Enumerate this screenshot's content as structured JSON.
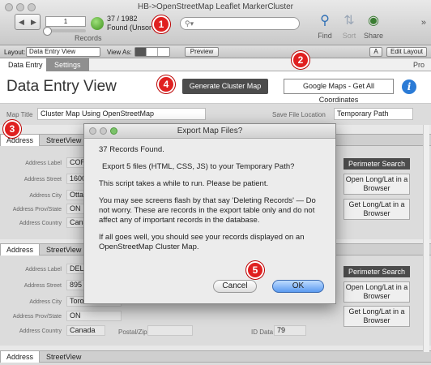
{
  "window": {
    "title": "HB->OpenStreetMap Leaflet MarkerCluster"
  },
  "toolbar": {
    "nav_prev": "◀",
    "nav_next": "▶",
    "record_number": "1",
    "records_label": "Records",
    "found_count": "37 / 1982",
    "found_status": "Found (Unsor",
    "search_placeholder": "",
    "find_label": "Find",
    "sort_label": "Sort",
    "share_label": "Share",
    "more_icon": "double-chevron"
  },
  "layoutbar": {
    "layout_label": "Layout:",
    "layout_value": "Data Entry View",
    "view_as_label": "View As:",
    "preview_label": "Preview",
    "font_size_label": "A",
    "edit_layout_label": "Edit Layout"
  },
  "tabs": {
    "data_entry": "Data Entry",
    "settings": "Settings",
    "pro": "Pro"
  },
  "header": {
    "title": "Data Entry View",
    "generate_button": "Generate Cluster Map",
    "google_maps_button": "Google Maps - Get All Coordinates"
  },
  "map_row": {
    "map_title_label": "Map Title",
    "map_title_value": "Cluster Map Using OpenStreetMap",
    "save_location_label": "Save File Location",
    "save_location_value": "Temporary Path"
  },
  "records": [
    {
      "tab_address": "Address",
      "tab_streetview": "StreetView",
      "address_label": "Address Label",
      "address_label_value": "COREL",
      "street_label": "Address Street",
      "street_value": "1600 Ca",
      "city_label": "Address City",
      "city_value": "Ottawa",
      "prov_label": "Address Prov/State",
      "prov_value": "ON",
      "country_label": "Address Country",
      "country_value": "Canada",
      "perimeter_button": "Perimeter Search",
      "open_longlat_button": "Open Long/Lat in a Browser",
      "get_longlat_button": "Get Long/Lat in a Browser"
    },
    {
      "tab_address": "Address",
      "tab_streetview": "StreetView",
      "address_label": "Address Label",
      "address_label_value": "DELRIN",
      "street_label": "Address Street",
      "street_value": "895 Don",
      "city_label": "Address City",
      "city_value": "Toronto",
      "prov_label": "Address Prov/State",
      "prov_value": "ON",
      "country_label": "Address Country",
      "country_value": "Canada",
      "postal_label": "Postal/Zip:",
      "id_label": "ID Data",
      "id_value": "79",
      "perimeter_button": "Perimeter Search",
      "open_longlat_button": "Open Long/Lat in a Browser",
      "get_longlat_button": "Get Long/Lat in a Browser"
    },
    {
      "tab_address": "Address",
      "tab_streetview": "StreetView"
    }
  ],
  "dialog": {
    "title": "Export Map Files?",
    "line1": "37 Records Found.",
    "line2": "Export 5 files (HTML, CSS, JS) to your Temporary Path?",
    "line3": "This script takes a while to run. Please be patient.",
    "line4": "You may see screens flash by that say 'Deleting Records' — Do not worry. These are records in the export table only and do not affect any of important records in the database.",
    "line5": "If all goes well, you should see your records displayed on an OpenStreetMap Cluster Map.",
    "cancel": "Cancel",
    "ok": "OK"
  },
  "badges": [
    "1",
    "2",
    "3",
    "4",
    "5"
  ],
  "colors": {
    "badge": "#e02020",
    "dark_button": "#4c4c4c",
    "ok_blue": "#5b9bf0",
    "info_blue": "#2b7bd6"
  }
}
